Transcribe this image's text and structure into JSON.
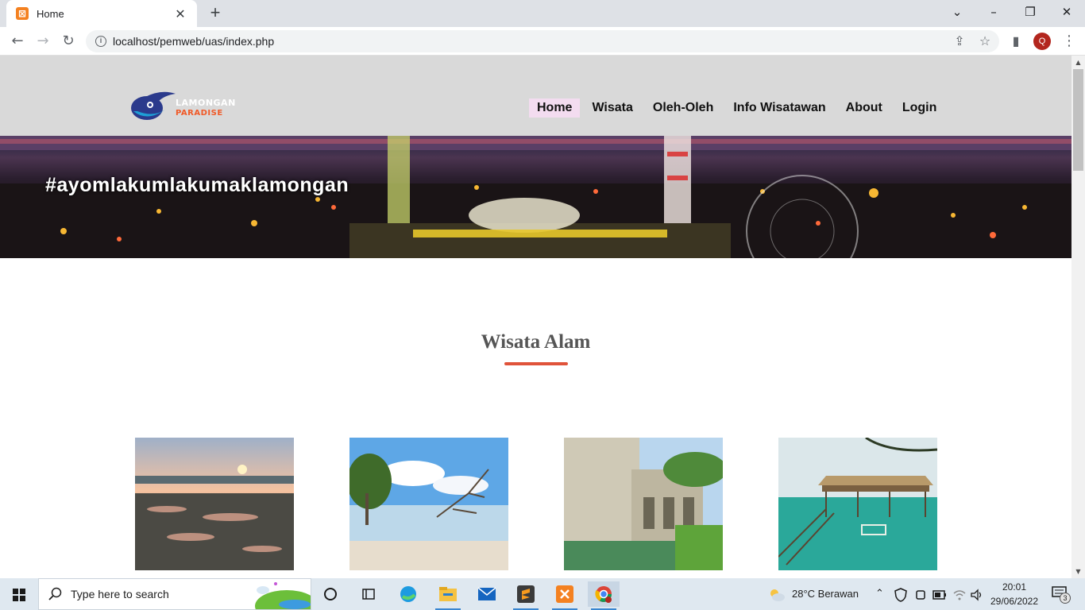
{
  "browser": {
    "tab_title": "Home",
    "tab_favicon_glyph": "⊠",
    "url": "localhost/pemweb/uas/index.php",
    "profile_initial": "Q"
  },
  "site": {
    "logo": {
      "line1": "LAMONGAN",
      "line2": "PARADISE"
    },
    "nav": [
      "Home",
      "Wisata",
      "Oleh-Oleh",
      "Info Wisatawan",
      "About",
      "Login"
    ],
    "hero_text": "#ayomlakumlakumaklamongan",
    "section_title": "Wisata Alam",
    "accent_color": "#e0533a",
    "nav_active_color": "#f3dcf0",
    "header_bg": "#d9d9d9"
  },
  "taskbar": {
    "search_placeholder": "Type here to search",
    "weather": "28°C  Berawan",
    "time": "20:01",
    "date": "29/06/2022",
    "notification_count": "3"
  }
}
